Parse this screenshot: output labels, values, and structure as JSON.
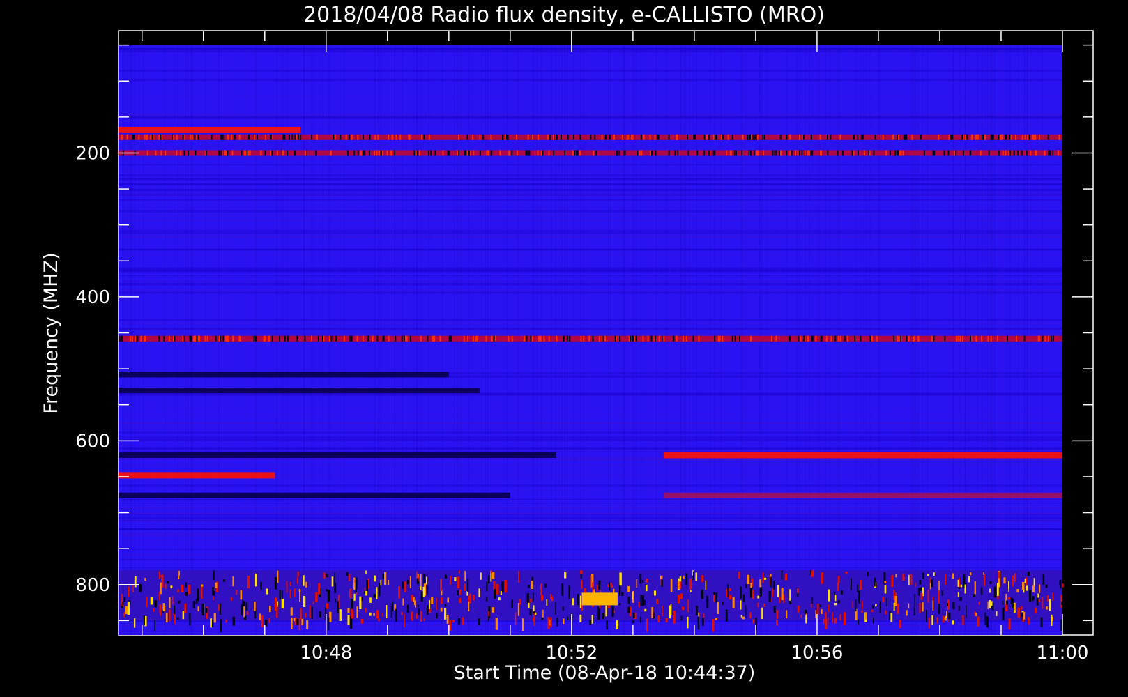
{
  "chart_data": {
    "type": "heatmap",
    "title": "2018/04/08  Radio flux density, e-CALLISTO (MRO)",
    "xlabel": "Start Time (08-Apr-18 10:44:37)",
    "ylabel": "Frequency (MHZ)",
    "x_start": "10:44:37",
    "x_end": "11:00:00",
    "x_axis_range": [
      "10:44:37",
      "11:00:30"
    ],
    "x_major_ticks": [
      "10:48",
      "10:52",
      "10:56",
      "11:00"
    ],
    "y_range": [
      50,
      870
    ],
    "y_axis_range": [
      30,
      870
    ],
    "y_major_ticks": [
      200,
      400,
      600,
      800
    ],
    "y_inverted": true,
    "colormap": [
      "#000000",
      "#0a00f0",
      "#ff0000",
      "#ffff00",
      "#ffffff"
    ],
    "background_color": "#2a13f2",
    "notable_features": [
      {
        "kind": "horizontal_band",
        "freq_mhz": 168,
        "t_start": "10:44:37",
        "t_end": "10:47:35",
        "level": "high"
      },
      {
        "kind": "horizontal_band",
        "freq_mhz": 178,
        "t_start": "10:44:37",
        "t_end": "11:00:00",
        "level": "mixed"
      },
      {
        "kind": "horizontal_band",
        "freq_mhz": 200,
        "t_start": "10:44:37",
        "t_end": "11:00:00",
        "level": "mixed"
      },
      {
        "kind": "horizontal_band",
        "freq_mhz": 458,
        "t_start": "10:44:37",
        "t_end": "11:00:00",
        "level": "mixed"
      },
      {
        "kind": "horizontal_band",
        "freq_mhz": 508,
        "t_start": "10:44:37",
        "t_end": "10:50:00",
        "level": "low"
      },
      {
        "kind": "horizontal_band",
        "freq_mhz": 530,
        "t_start": "10:44:37",
        "t_end": "10:50:30",
        "level": "low"
      },
      {
        "kind": "horizontal_band",
        "freq_mhz": 620,
        "t_start": "10:44:37",
        "t_end": "10:51:45",
        "level": "low"
      },
      {
        "kind": "horizontal_band",
        "freq_mhz": 620,
        "t_start": "10:53:30",
        "t_end": "11:00:00",
        "level": "high"
      },
      {
        "kind": "horizontal_band",
        "freq_mhz": 648,
        "t_start": "10:44:37",
        "t_end": "10:47:10",
        "level": "high"
      },
      {
        "kind": "horizontal_band",
        "freq_mhz": 676,
        "t_start": "10:44:37",
        "t_end": "10:51:00",
        "level": "low"
      },
      {
        "kind": "horizontal_band",
        "freq_mhz": 676,
        "t_start": "10:53:30",
        "t_end": "11:00:00",
        "level": "medium"
      },
      {
        "kind": "broadband_noise",
        "freq_range": [
          780,
          850
        ],
        "t_start": "10:44:37",
        "t_end": "11:00:00",
        "level": "high"
      },
      {
        "kind": "burst",
        "freq_mhz": 820,
        "t_start": "10:52:10",
        "t_end": "10:52:45",
        "level": "very_high"
      }
    ]
  }
}
